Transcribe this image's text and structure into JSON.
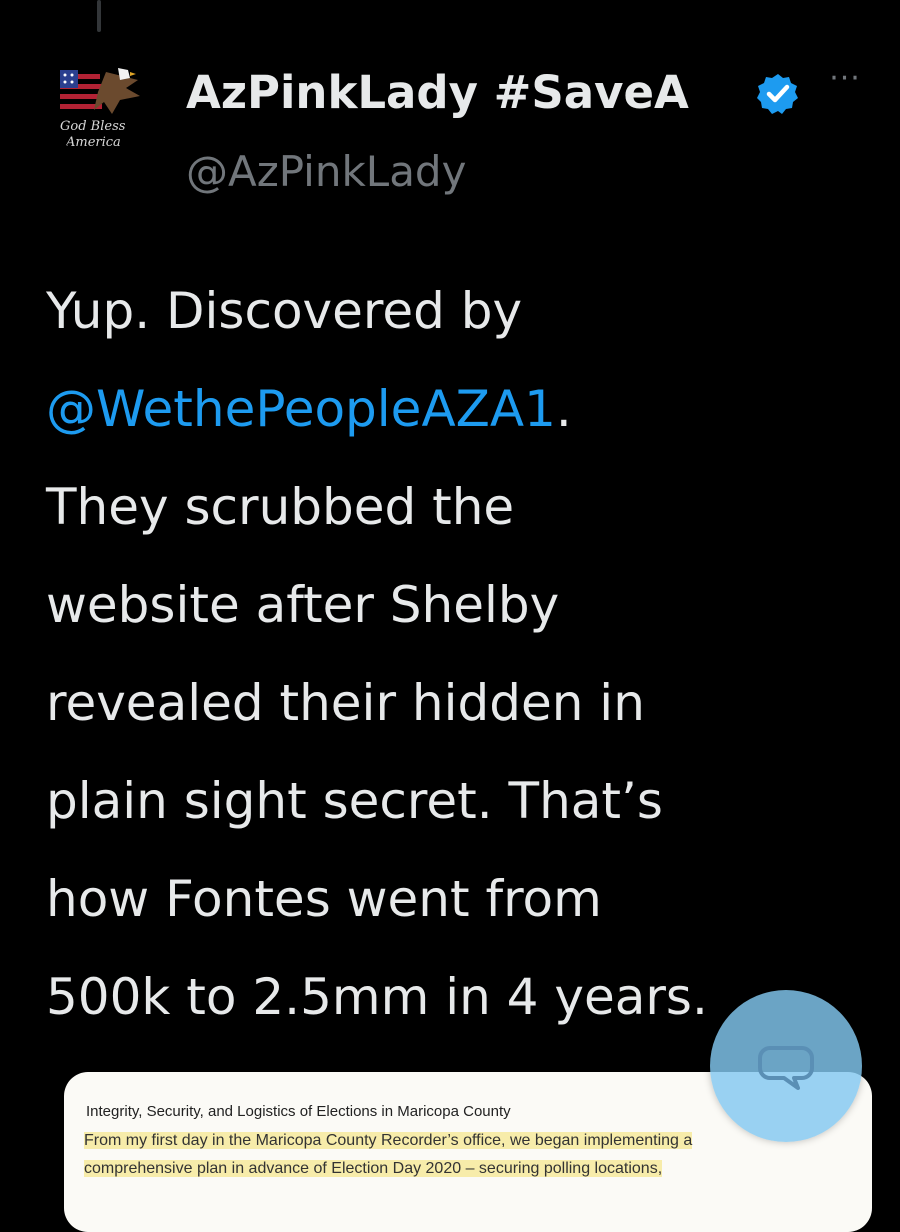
{
  "post": {
    "author": {
      "display_name": "AzPinkLady #SaveA",
      "handle": "@AzPinkLady",
      "verified": true,
      "avatar_icon": "eagle-flag-avatar",
      "avatar_text_1": "God Bless",
      "avatar_text_2": "America"
    },
    "more_label": "···",
    "text_lines": [
      {
        "text": "Yup.  Discovered by",
        "is_mention": false
      },
      {
        "mention": "@WethePeopleAZA1",
        "suffix": "."
      },
      {
        "text": "They scrubbed the"
      },
      {
        "text": "website after Shelby"
      },
      {
        "text": "revealed their hidden in"
      },
      {
        "text": "plain sight secret.  That’s"
      },
      {
        "text": "how Fontes went from"
      },
      {
        "text": "500k to 2.5mm in 4 years."
      }
    ],
    "media": {
      "doc_title": "Integrity, Security, and Logistics of Elections in Maricopa County",
      "doc_line_1": "From my first day in the Maricopa County Recorder’s office, we began implementing a",
      "doc_line_2": "comprehensive plan in advance of Election Day 2020 – securing polling locations,"
    }
  },
  "floating_button": {
    "icon": "chat-bubble-icon"
  },
  "colors": {
    "background": "#000000",
    "text": "#e7e9ea",
    "secondary": "#71767b",
    "mention": "#1d9bf0",
    "verified_badge": "#1d9bf0",
    "highlight": "#f7ecaa"
  }
}
